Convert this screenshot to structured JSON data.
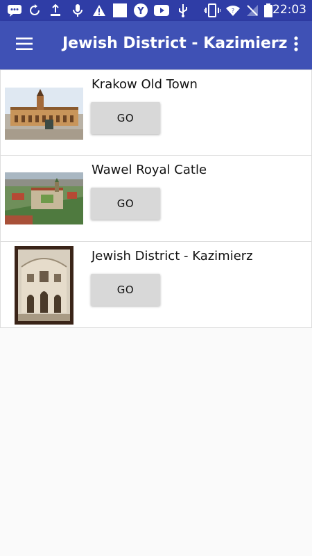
{
  "status_bar": {
    "time": "22:03",
    "icons": [
      "chat-icon",
      "sync-icon",
      "upload-icon",
      "mic-icon",
      "warning-icon",
      "blank-app-icon",
      "yandex-icon",
      "youtube-icon",
      "usb-icon",
      "vibrate-icon",
      "wifi-icon",
      "no-signal-icon",
      "battery-icon"
    ]
  },
  "app_bar": {
    "title": "Jewish District - Kazimierz",
    "menu_icon": "hamburger-menu-icon",
    "more_icon": "more-vert-icon"
  },
  "places": [
    {
      "title": "Krakow Old Town",
      "button": "GO",
      "image": "cloth-hall-photo"
    },
    {
      "title": "Wawel Royal Catle",
      "button": "GO",
      "image": "wawel-castle-photo"
    },
    {
      "title": "Jewish District - Kazimierz",
      "button": "GO",
      "image": "synagogue-photo"
    }
  ],
  "colors": {
    "status_bar": "#2f3da6",
    "app_bar": "#3f51b5",
    "button": "#d8d8d8",
    "background": "#fafafa"
  }
}
